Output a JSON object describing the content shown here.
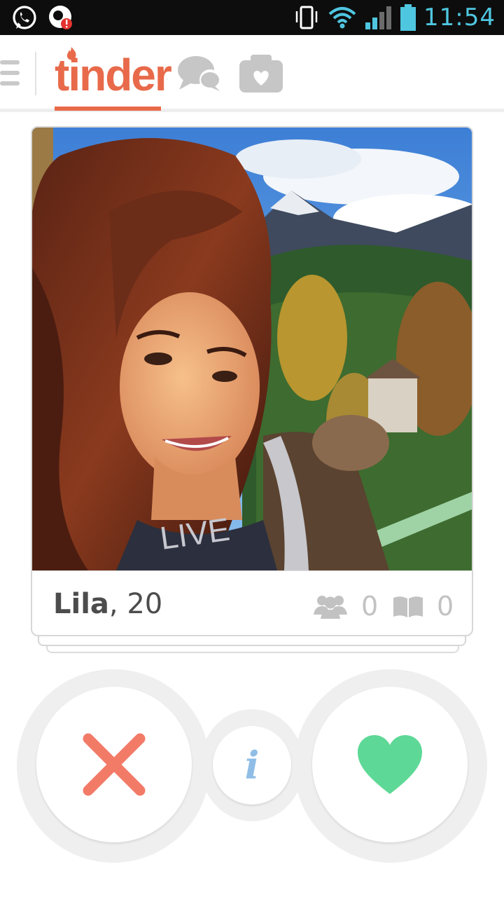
{
  "status_bar": {
    "time": "11:54",
    "left_icons": [
      "whatsapp-icon",
      "notification-alert-icon"
    ],
    "right_icons": [
      "vibrate-icon",
      "wifi-icon",
      "signal-icon",
      "battery-icon"
    ]
  },
  "header": {
    "logo_text": "tinder",
    "tabs": [
      "tinder",
      "messages",
      "moments"
    ],
    "active_tab": "tinder",
    "accent_color": "#e86a4a"
  },
  "profile": {
    "name": "Lila",
    "age_text": ", 20",
    "shared_friends": "0",
    "shared_interests": "0"
  },
  "actions": {
    "nope_icon": "close-icon",
    "info_label": "i",
    "like_icon": "heart-icon",
    "nope_color": "#f27b68",
    "info_color": "#8fbde6",
    "like_color": "#5ed896"
  }
}
